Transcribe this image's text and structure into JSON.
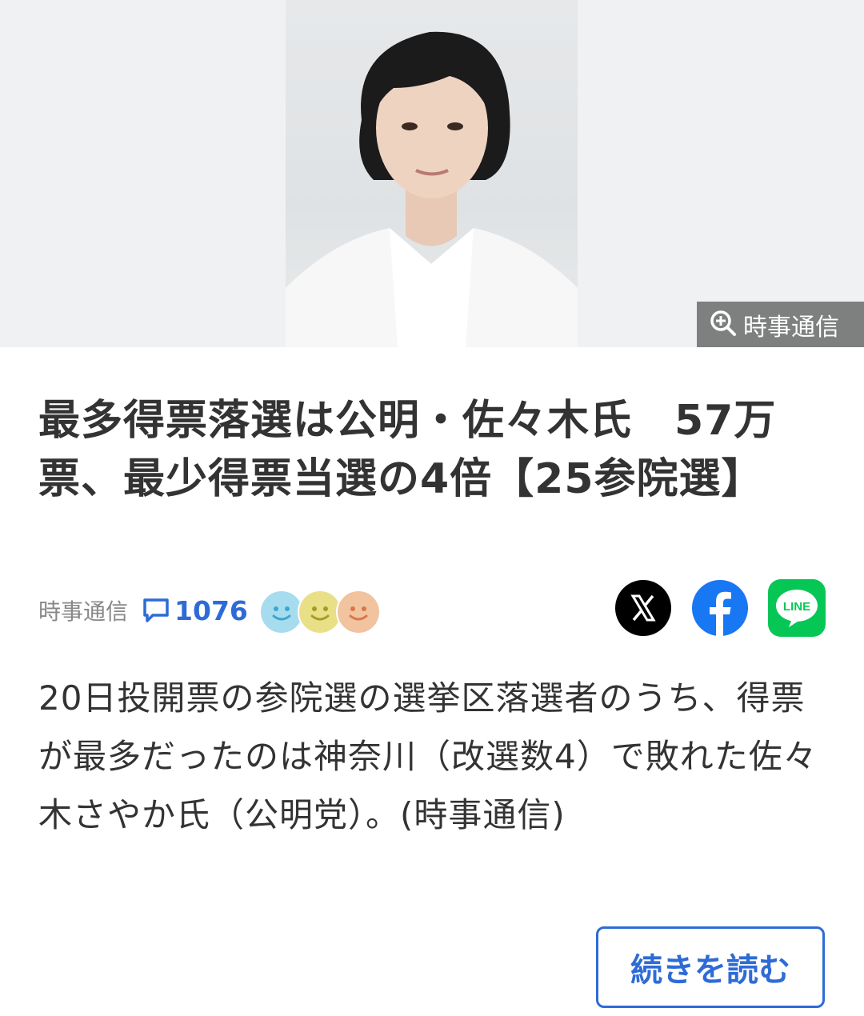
{
  "hero": {
    "photo_alt": "portrait-photo",
    "credit_icon": "zoom-in-icon",
    "credit_label": "時事通信"
  },
  "article": {
    "title": "最多得票落選は公明・佐々木氏　57万票、最少得票当選の4倍【25参院選】",
    "source": "時事通信",
    "comment_icon": "comment-icon",
    "comment_count": "1076",
    "reaction_icons": [
      "smile-blue-icon",
      "smile-yellow-icon",
      "smile-orange-icon"
    ],
    "reaction_colors": [
      "#a7dcef",
      "#e9df86",
      "#f2c39f"
    ],
    "summary": "20日投開票の参院選の選挙区落選者のうち、得票が最多だったのは神奈川（改選数4）で敗れた佐々木さやか氏（公明党）。(時事通信)"
  },
  "share": {
    "x_icon": "x-logo-icon",
    "facebook_icon": "facebook-logo-icon",
    "line_label": "LINE"
  },
  "read_more": {
    "label": "続きを読む"
  },
  "colors": {
    "accent": "#2e6bd6",
    "title_text": "#333333",
    "meta_text": "#888888",
    "facebook": "#1877f2",
    "line": "#06c755",
    "x": "#000000"
  }
}
